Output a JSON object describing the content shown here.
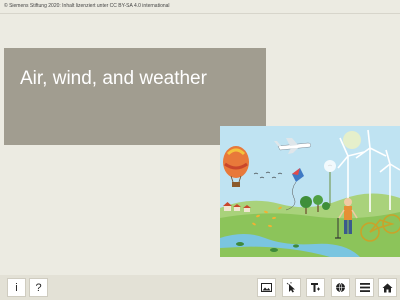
{
  "license": "© Siemens Stiftung 2020: Inhalt lizenziert unter CC BY-SA 4.0 international",
  "title": "Air, wind, and weather",
  "colors": {
    "background": "#ecebe2",
    "title_panel": "#a19d90",
    "title_text": "#ffffff",
    "bottom_bar": "#e3e1d6"
  },
  "toolbar": {
    "left": [
      {
        "name": "info",
        "label": "i",
        "icon": "info-icon"
      },
      {
        "name": "help",
        "label": "?",
        "icon": "help-icon"
      }
    ],
    "right": [
      {
        "name": "media",
        "icon": "image-icon"
      },
      {
        "name": "interactive",
        "icon": "pointer-icon"
      },
      {
        "name": "text-settings",
        "icon": "text-icon"
      },
      {
        "name": "language",
        "icon": "globe-icon"
      },
      {
        "name": "menu",
        "icon": "hamburger-menu-icon"
      },
      {
        "name": "home",
        "icon": "home-icon"
      }
    ]
  },
  "illustration": {
    "subject": "weather scene"
  }
}
